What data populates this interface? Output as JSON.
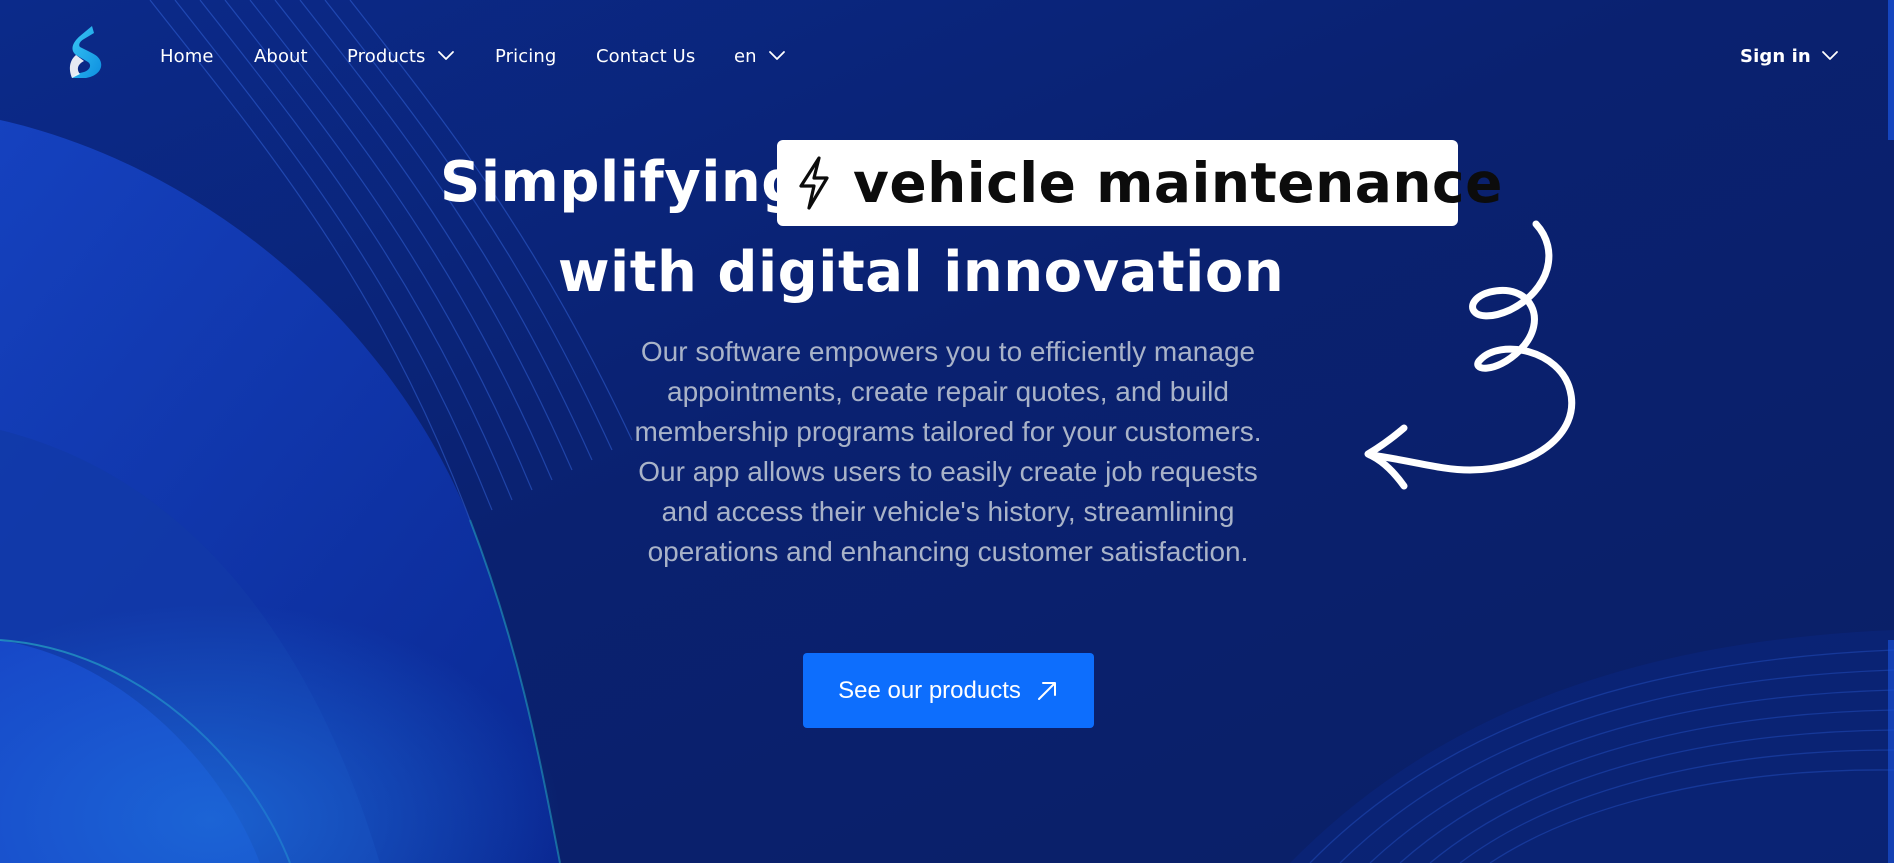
{
  "nav": {
    "logo_icon": "brand-s-logo",
    "items": [
      {
        "label": "Home"
      },
      {
        "label": "About"
      },
      {
        "label": "Products",
        "icon": "chevron-down-icon"
      },
      {
        "label": "Pricing"
      },
      {
        "label": "Contact Us"
      }
    ],
    "language": {
      "label": "en",
      "icon": "chevron-down-icon"
    },
    "signin": {
      "label": "Sign in",
      "icon": "chevron-down-icon"
    }
  },
  "hero": {
    "title_prefix": "Simplifying",
    "title_highlight": "vehicle maintenance",
    "highlight_icon": "lightning-bolt-icon",
    "title_line2": "with digital innovation",
    "description": "Our software empowers you to efficiently manage appointments, create repair quotes, and build membership programs tailored for your customers. Our app allows users to easily create job requests and access their vehicle's history, streamlining operations and enhancing customer satisfaction.",
    "cta_label": "See our products",
    "cta_icon": "arrow-up-right-icon",
    "decoration_icon": "curly-arrow-icon"
  },
  "colors": {
    "background": "#0a2472",
    "accent": "#0d6efd",
    "highlight_bg": "#ffffff",
    "description_text": "#a9b3c8"
  }
}
